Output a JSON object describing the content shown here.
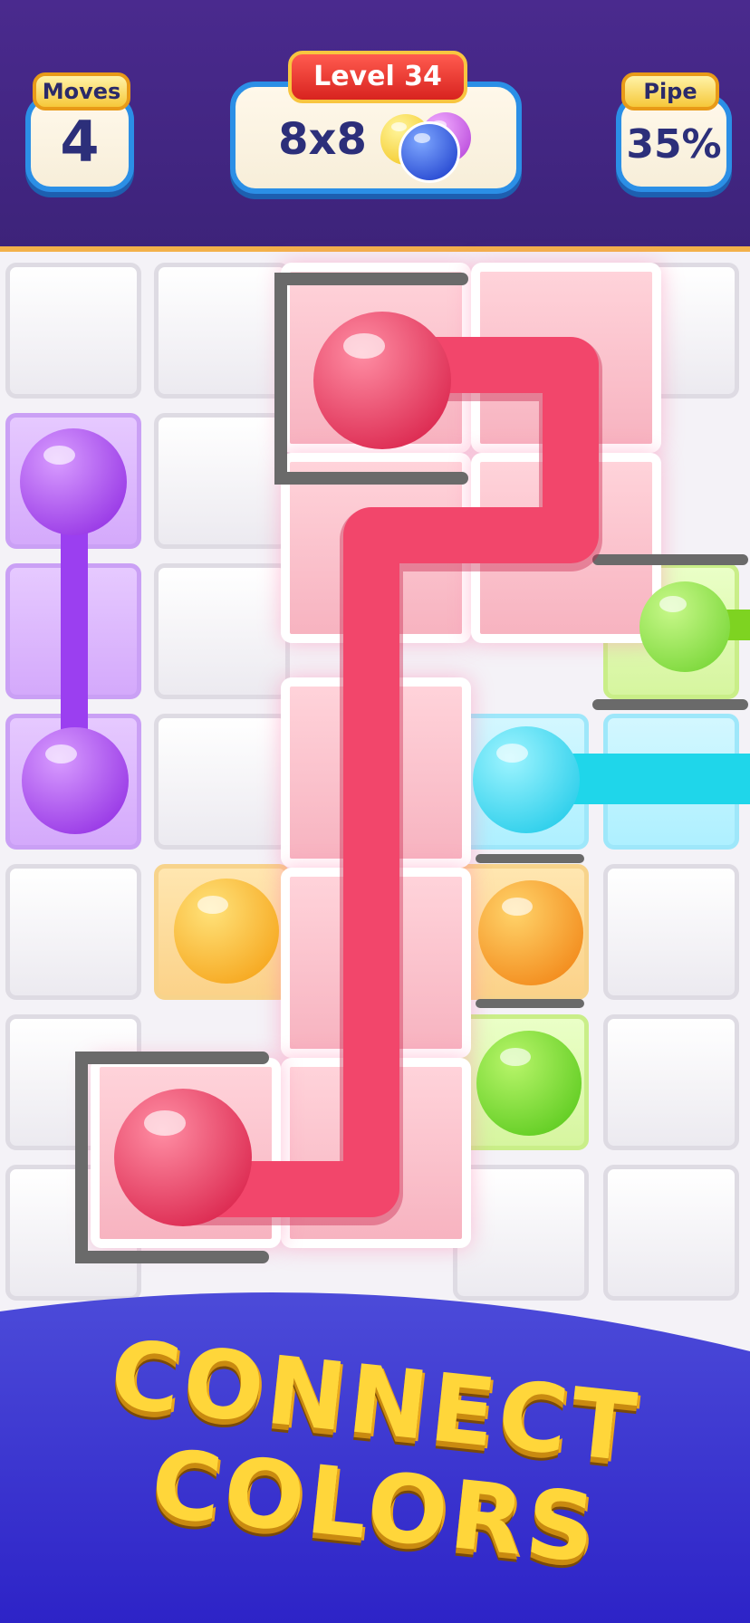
{
  "hud": {
    "moves_label": "Moves",
    "moves_value": "4",
    "level_label": "Level 34",
    "grid_size": "8x8",
    "pipe_label": "Pipe",
    "pipe_value": "35%"
  },
  "board": {
    "rows": 7,
    "columns": 5,
    "paths": [
      {
        "color": "purple",
        "hex": "#9b3ff0"
      },
      {
        "color": "red",
        "hex": "#f2466b"
      },
      {
        "color": "cyan",
        "hex": "#1fd6ea"
      },
      {
        "color": "green",
        "hex": "#7ed321"
      }
    ],
    "dots": [
      "purple",
      "red",
      "orange",
      "green",
      "cyan"
    ]
  },
  "banner": {
    "line1": "CONNECT",
    "line2": "COLORS"
  },
  "colors": {
    "header_bg": "#3d237a",
    "banner_bg": "#3b35d8",
    "title_yellow": "#ffd63a"
  }
}
